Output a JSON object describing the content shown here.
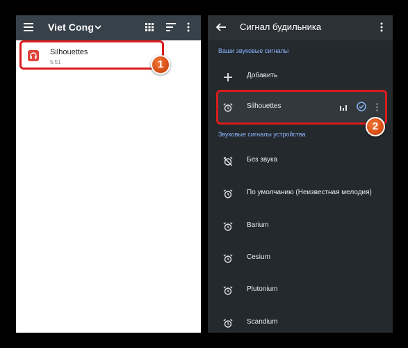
{
  "left": {
    "appbar": {
      "folder_title": "Viet Cong",
      "icons": [
        "menu-icon",
        "chevron-down-icon",
        "grid-view-icon",
        "sort-icon",
        "more-vert-icon"
      ]
    },
    "track": {
      "title": "Silhouettes",
      "duration": "5:51",
      "art_color": "#e0443a"
    }
  },
  "right": {
    "appbar": {
      "title": "Сигнал будильника",
      "icons": [
        "back-arrow-icon",
        "more-vert-icon"
      ]
    },
    "section_your": "Ваши звуковые сигналы",
    "add_label": "Добавить",
    "selected_item": "Silhouettes",
    "section_device": "Звуковые сигналы устройства",
    "device_items": [
      {
        "label": "Без звука",
        "icon": "alarm-off-icon"
      },
      {
        "label": "По умолчанию (Неизвестная мелодия)",
        "icon": "alarm-icon"
      },
      {
        "label": "Barium",
        "icon": "alarm-icon"
      },
      {
        "label": "Cesium",
        "icon": "alarm-icon"
      },
      {
        "label": "Plutonium",
        "icon": "alarm-icon"
      },
      {
        "label": "Scandium",
        "icon": "alarm-icon"
      }
    ]
  },
  "badges": {
    "one": "1",
    "two": "2"
  },
  "colors": {
    "left_appbar": "#37414a",
    "right_bg": "#24292e",
    "accent_blue": "#8ab4f8",
    "highlight_red": "#d91c1c",
    "badge_orange": "#d94f16"
  }
}
